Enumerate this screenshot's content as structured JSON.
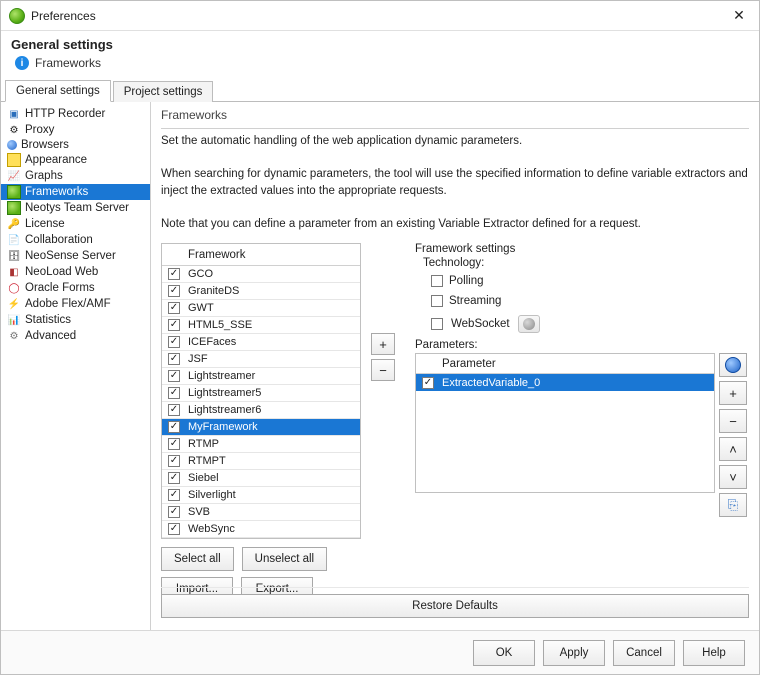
{
  "window": {
    "title": "Preferences"
  },
  "header": {
    "title": "General settings",
    "subtitle": "Frameworks"
  },
  "tabs": {
    "general": "General settings",
    "project": "Project settings"
  },
  "sidebar": {
    "items": [
      {
        "label": "HTTP Recorder",
        "icon": "ic-rec"
      },
      {
        "label": "Proxy",
        "icon": "ic-gear"
      },
      {
        "label": "Browsers",
        "icon": "ic-ball"
      },
      {
        "label": "Appearance",
        "icon": "ic-app"
      },
      {
        "label": "Graphs",
        "icon": "ic-graph"
      },
      {
        "label": "Frameworks",
        "icon": "ic-fw",
        "selected": true
      },
      {
        "label": "Neotys Team Server",
        "icon": "ic-fw"
      },
      {
        "label": "License",
        "icon": "ic-key"
      },
      {
        "label": "Collaboration",
        "icon": "ic-note"
      },
      {
        "label": "NeoSense Server",
        "icon": "ic-db"
      },
      {
        "label": "NeoLoad Web",
        "icon": "ic-cube"
      },
      {
        "label": "Oracle Forms",
        "icon": "ic-ring"
      },
      {
        "label": "Adobe Flex/AMF",
        "icon": "ic-flash"
      },
      {
        "label": "Statistics",
        "icon": "ic-stats"
      },
      {
        "label": "Advanced",
        "icon": "ic-adv"
      }
    ]
  },
  "main": {
    "title": "Frameworks",
    "desc1": "Set the automatic handling of the web application dynamic parameters.",
    "desc2": "When searching for dynamic parameters, the tool will use the specified information to define variable extractors and inject the extracted values into the appropriate requests.",
    "desc3": "Note that you can define a parameter from an existing Variable Extractor defined for a request."
  },
  "frameworks": {
    "header": "Framework",
    "items": [
      {
        "label": "GCO",
        "checked": true
      },
      {
        "label": "GraniteDS",
        "checked": true
      },
      {
        "label": "GWT",
        "checked": true
      },
      {
        "label": "HTML5_SSE",
        "checked": true
      },
      {
        "label": "ICEFaces",
        "checked": true
      },
      {
        "label": "JSF",
        "checked": true
      },
      {
        "label": "Lightstreamer",
        "checked": true
      },
      {
        "label": "Lightstreamer5",
        "checked": true
      },
      {
        "label": "Lightstreamer6",
        "checked": true
      },
      {
        "label": "MyFramework",
        "checked": true,
        "selected": true
      },
      {
        "label": "RTMP",
        "checked": true
      },
      {
        "label": "RTMPT",
        "checked": true
      },
      {
        "label": "Siebel",
        "checked": true
      },
      {
        "label": "Silverlight",
        "checked": true
      },
      {
        "label": "SVB",
        "checked": true
      },
      {
        "label": "WebSync",
        "checked": true
      }
    ]
  },
  "buttons": {
    "add": "+",
    "remove": "−",
    "select_all": "Select all",
    "unselect_all": "Unselect all",
    "import": "Import...",
    "export": "Export...",
    "restore": "Restore Defaults",
    "ok": "OK",
    "apply": "Apply",
    "cancel": "Cancel",
    "help": "Help"
  },
  "settings": {
    "section": "Framework settings",
    "tech_label": "Technology:",
    "polling": "Polling",
    "streaming": "Streaming",
    "websocket": "WebSocket",
    "params_label": "Parameters:",
    "param_header": "Parameter",
    "param_items": [
      {
        "label": "ExtractedVariable_0",
        "checked": true,
        "selected": true
      }
    ]
  }
}
